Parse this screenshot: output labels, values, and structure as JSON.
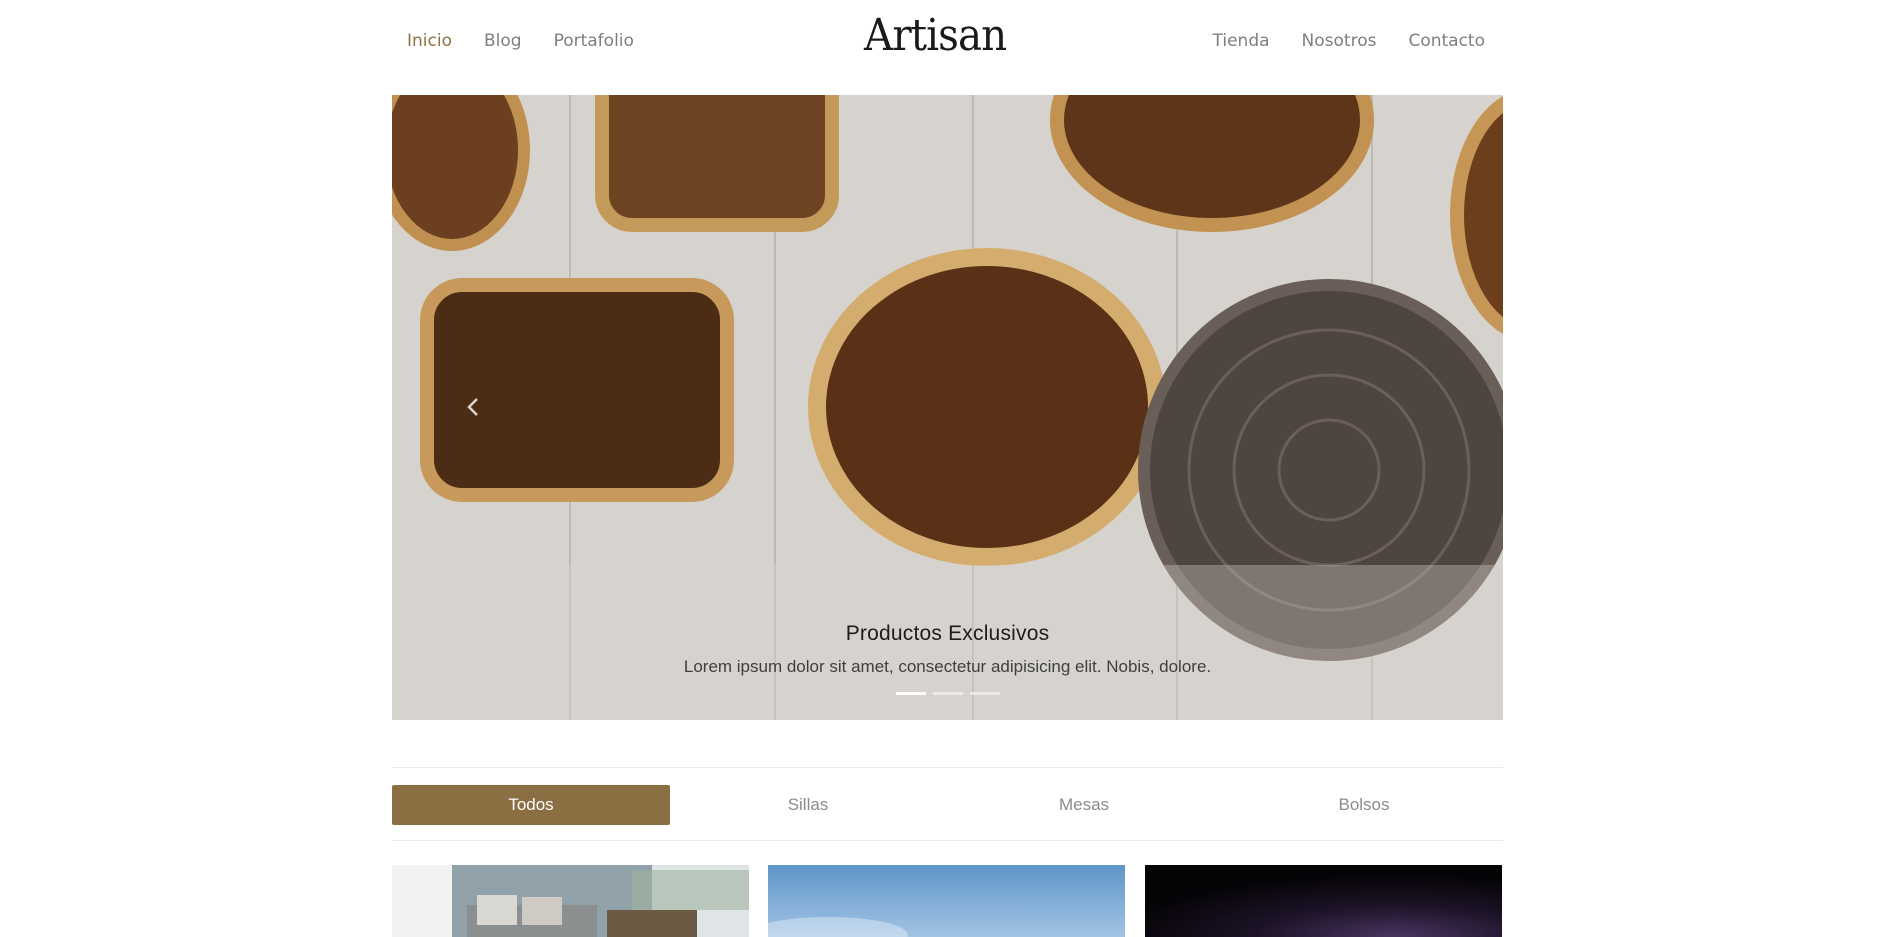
{
  "header": {
    "logo": "Artisan",
    "nav_left": [
      {
        "label": "Inicio",
        "active": true
      },
      {
        "label": "Blog",
        "active": false
      },
      {
        "label": "Portafolio",
        "active": false
      }
    ],
    "nav_right": [
      {
        "label": "Tienda"
      },
      {
        "label": "Nosotros"
      },
      {
        "label": "Contacto"
      }
    ],
    "active_color": "#8d7447"
  },
  "hero": {
    "title": "Productos Exclusivos",
    "text": "Lorem ipsum dolor sit amet, consectetur adipisicing elit. Nobis, dolore.",
    "slides_count": 3,
    "active_slide": 1,
    "prev_icon": "chevron-left-icon"
  },
  "filters": {
    "items": [
      {
        "label": "Todos",
        "active": true
      },
      {
        "label": "Sillas",
        "active": false
      },
      {
        "label": "Mesas",
        "active": false
      },
      {
        "label": "Bolsos",
        "active": false
      }
    ],
    "active_color": "#8b6f43"
  }
}
